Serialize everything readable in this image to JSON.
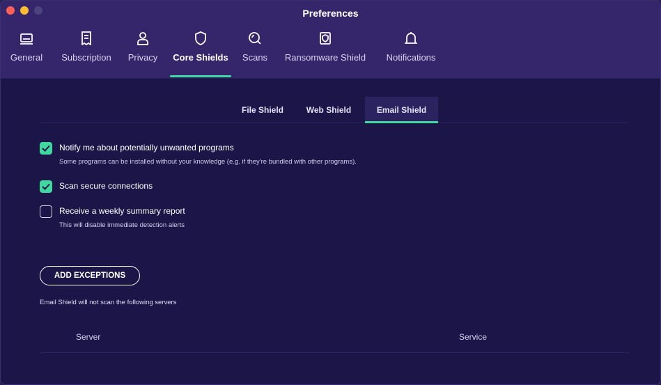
{
  "window": {
    "title": "Preferences"
  },
  "tabs": [
    {
      "label": "General",
      "icon": "monitor-icon"
    },
    {
      "label": "Subscription",
      "icon": "receipt-icon"
    },
    {
      "label": "Privacy",
      "icon": "person-icon"
    },
    {
      "label": "Core Shields",
      "icon": "shield-icon",
      "active": true
    },
    {
      "label": "Scans",
      "icon": "magnifier-scan-icon"
    },
    {
      "label": "Ransomware Shield",
      "icon": "folder-shield-icon"
    },
    {
      "label": "Notifications",
      "icon": "bell-icon"
    }
  ],
  "subtabs": [
    {
      "label": "File Shield"
    },
    {
      "label": "Web Shield"
    },
    {
      "label": "Email Shield",
      "active": true
    }
  ],
  "options": [
    {
      "label": "Notify me about potentially unwanted programs",
      "description": "Some programs can be installed without your knowledge (e.g. if they're bundled with other programs).",
      "checked": true
    },
    {
      "label": "Scan secure connections",
      "description": "",
      "checked": true
    },
    {
      "label": "Receive a weekly summary report",
      "description": "This will disable immediate detection alerts",
      "checked": false
    }
  ],
  "add_exceptions_label": "ADD EXCEPTIONS",
  "exceptions_note": "Email Shield will not scan the following servers",
  "table": {
    "columns": [
      "Server",
      "Service"
    ]
  },
  "colors": {
    "accent": "#3fd9a0",
    "background": "#1b1548",
    "toolbar": "#35256a"
  }
}
